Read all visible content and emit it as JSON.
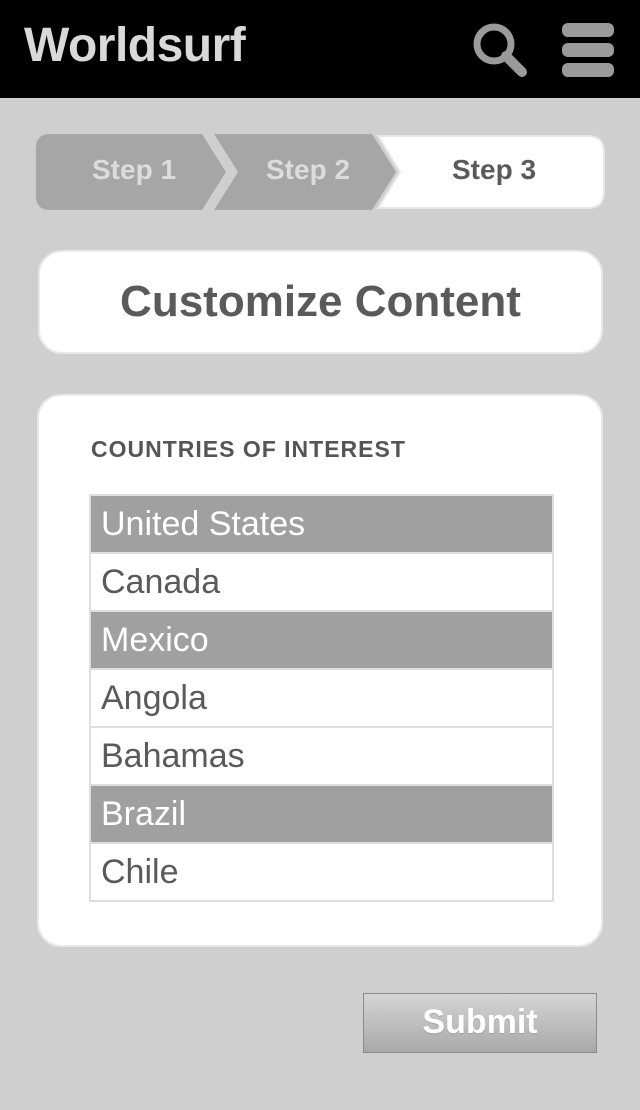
{
  "header": {
    "app_title": "Worldsurf",
    "search_icon": "search-icon",
    "menu_icon": "menu-icon"
  },
  "stepper": {
    "steps": [
      {
        "label": "Step 1",
        "state": "completed"
      },
      {
        "label": "Step 2",
        "state": "completed"
      },
      {
        "label": "Step 3",
        "state": "current"
      }
    ]
  },
  "page": {
    "title": "Customize Content"
  },
  "countries": {
    "section_label": "COUNTRIES OF INTEREST",
    "items": [
      {
        "label": "United States",
        "selected": true
      },
      {
        "label": "Canada",
        "selected": false
      },
      {
        "label": "Mexico",
        "selected": true
      },
      {
        "label": "Angola",
        "selected": false
      },
      {
        "label": "Bahamas",
        "selected": false
      },
      {
        "label": "Brazil",
        "selected": true
      },
      {
        "label": "Chile",
        "selected": false
      }
    ]
  },
  "actions": {
    "submit_label": "Submit"
  },
  "colors": {
    "header_bg": "#000000",
    "page_bg": "#cfcfcf",
    "step_inactive": "#a6a6a6",
    "step_active": "#ffffff",
    "selected_row": "#a0a0a0",
    "text_dark": "#5a5a5a"
  }
}
